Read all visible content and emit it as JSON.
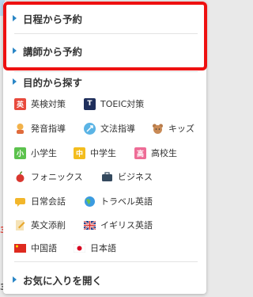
{
  "background": {
    "left_text_1": "3",
    "left_text_2": "3"
  },
  "menu": {
    "top_items": [
      {
        "label": "日程から予約"
      },
      {
        "label": "講師から予約"
      }
    ],
    "purpose_header": "目的から探す",
    "purpose_items": [
      {
        "label": "英検対策",
        "icon": "eiken-icon"
      },
      {
        "label": "TOEIC対策",
        "icon": "toeic-icon"
      },
      {
        "label": "発音指導",
        "icon": "pronunciation-icon"
      },
      {
        "label": "文法指導",
        "icon": "grammar-icon"
      },
      {
        "label": "キッズ",
        "icon": "kids-bear-icon"
      },
      {
        "label": "小学生",
        "icon": "elementary-icon"
      },
      {
        "label": "中学生",
        "icon": "junior-high-icon"
      },
      {
        "label": "高校生",
        "icon": "high-school-icon"
      },
      {
        "label": "フォニックス",
        "icon": "phonics-icon"
      },
      {
        "label": "ビジネス",
        "icon": "briefcase-icon"
      },
      {
        "label": "日常会話",
        "icon": "daily-conversation-icon"
      },
      {
        "label": "トラベル英語",
        "icon": "globe-icon"
      },
      {
        "label": "英文添削",
        "icon": "correction-icon"
      },
      {
        "label": "イギリス英語",
        "icon": "uk-flag-icon"
      },
      {
        "label": "中国語",
        "icon": "china-flag-icon"
      },
      {
        "label": "日本語",
        "icon": "japan-flag-icon"
      }
    ],
    "favorites": "お気に入りを開く"
  },
  "icon_text": {
    "eiken": "英",
    "toeic": "T",
    "elementary": "小",
    "junior": "中",
    "high": "高"
  },
  "colors": {
    "accent": "#2a86c6",
    "highlight_border": "#ee1111"
  }
}
